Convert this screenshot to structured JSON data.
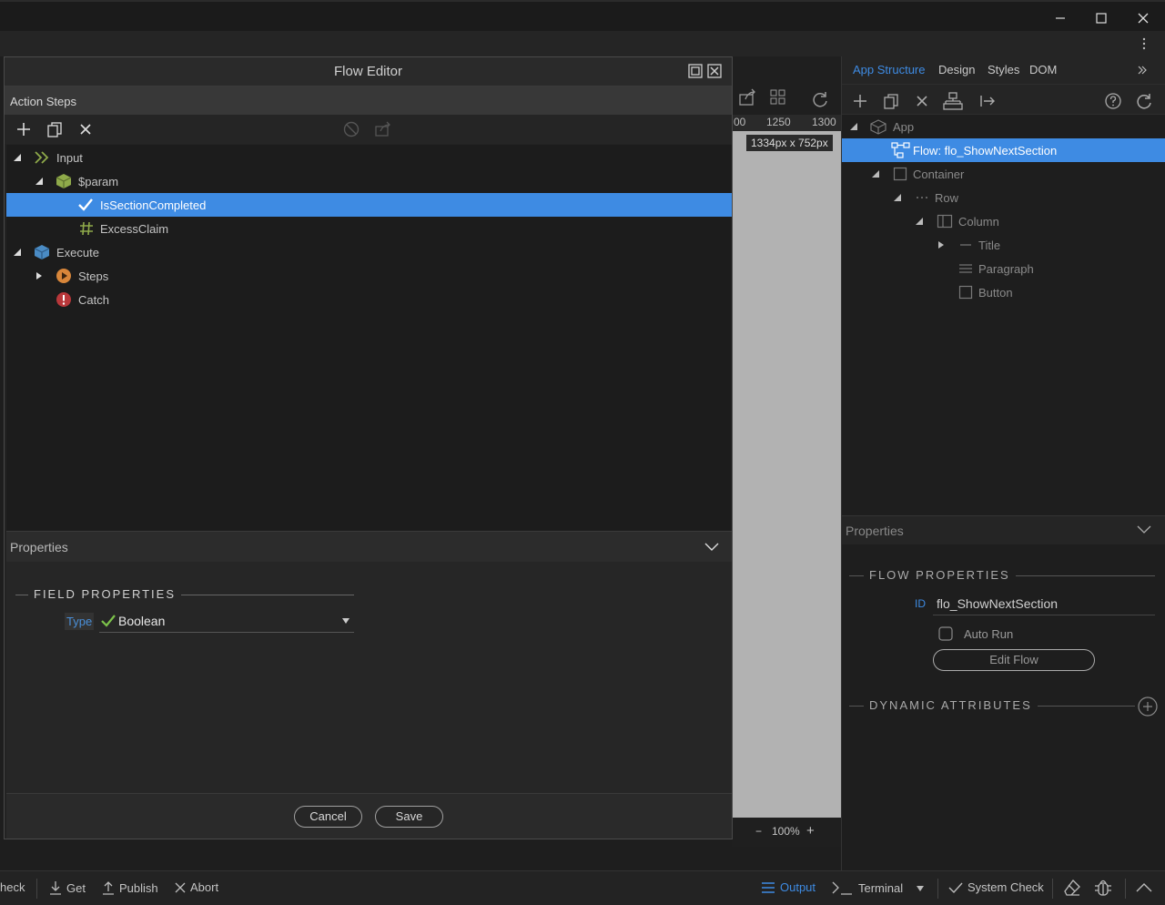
{
  "window": {
    "minimize_icon": "minimize-icon",
    "maximize_icon": "maximize-icon",
    "close_icon": "close-icon"
  },
  "right_panel": {
    "tabs": [
      "App Structure",
      "Design",
      "Styles",
      "DOM"
    ],
    "active_tab": "App Structure",
    "tree": [
      {
        "label": "App",
        "icon": "cube-icon"
      },
      {
        "label": "Flow: flo_ShowNextSection",
        "icon": "flow-icon",
        "selected": true
      },
      {
        "label": "Container",
        "icon": "square-icon"
      },
      {
        "label": "Row",
        "icon": "dots-icon"
      },
      {
        "label": "Column",
        "icon": "column-icon"
      },
      {
        "label": "Title",
        "icon": "dash-icon"
      },
      {
        "label": "Paragraph",
        "icon": "lines-icon"
      },
      {
        "label": "Button",
        "icon": "square-icon"
      }
    ],
    "properties_label": "Properties",
    "flow_properties_label": "FLOW PROPERTIES",
    "id_label": "ID",
    "id_value": "flo_ShowNextSection",
    "auto_run_label": "Auto Run",
    "edit_flow_label": "Edit Flow",
    "dynamic_attributes_label": "DYNAMIC ATTRIBUTES"
  },
  "canvas": {
    "ruler_labels": [
      "00",
      "1250",
      "1300"
    ],
    "size_badge": "1334px x 752px",
    "zoom": "100%",
    "zoom_minus": "−",
    "zoom_plus": "+"
  },
  "dialog": {
    "title": "Flow Editor",
    "action_steps_label": "Action Steps",
    "tree": [
      {
        "label": "Input",
        "level": 0,
        "expanded": true
      },
      {
        "label": "$param",
        "level": 1,
        "expanded": true
      },
      {
        "label": "IsSectionCompleted",
        "level": 2,
        "selected": true
      },
      {
        "label": "ExcessClaim",
        "level": 2
      },
      {
        "label": "Execute",
        "level": 0,
        "expanded": true
      },
      {
        "label": "Steps",
        "level": 1,
        "expanded": false
      },
      {
        "label": "Catch",
        "level": 1
      }
    ],
    "properties_label": "Properties",
    "field_properties_label": "FIELD PROPERTIES",
    "type_label": "Type",
    "type_value": "Boolean",
    "cancel_label": "Cancel",
    "save_label": "Save"
  },
  "bottom_bar": {
    "left_partial": "heck",
    "get_label": "Get",
    "publish_label": "Publish",
    "abort_label": "Abort",
    "output_label": "Output",
    "terminal_label": "Terminal",
    "system_check_label": "System Check"
  },
  "colors": {
    "accent": "#3e8be3",
    "selection": "#3e8be3",
    "error": "#c0392b",
    "orange": "#e08a3c",
    "green_check": "#7cc24a"
  }
}
